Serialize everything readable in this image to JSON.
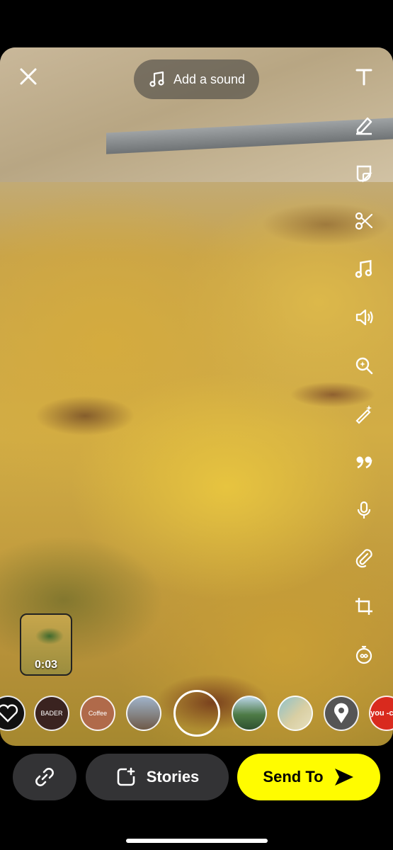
{
  "top": {
    "close_icon": "close-icon",
    "sound_label": "Add a sound",
    "sound_icon": "music-note-icon"
  },
  "tools": [
    {
      "name": "text-tool",
      "icon": "text-icon"
    },
    {
      "name": "draw-tool",
      "icon": "pencil-icon"
    },
    {
      "name": "sticker-tool",
      "icon": "sticker-icon"
    },
    {
      "name": "scissors-tool",
      "icon": "scissors-icon"
    },
    {
      "name": "music-tool",
      "icon": "music-note-icon"
    },
    {
      "name": "volume-tool",
      "icon": "volume-icon"
    },
    {
      "name": "search-lens-tool",
      "icon": "sparkle-search-icon"
    },
    {
      "name": "magic-tool",
      "icon": "magic-wand-icon"
    },
    {
      "name": "quote-tool",
      "icon": "quote-icon"
    },
    {
      "name": "voice-tool",
      "icon": "microphone-icon"
    },
    {
      "name": "attach-tool",
      "icon": "paperclip-icon"
    },
    {
      "name": "crop-tool",
      "icon": "crop-icon"
    },
    {
      "name": "timer-tool",
      "icon": "timer-icon"
    }
  ],
  "thumbnail": {
    "duration": "0:03"
  },
  "lenses": [
    {
      "name": "lens-heart",
      "label": "",
      "color": "#111111"
    },
    {
      "name": "lens-bader",
      "label": "BADER",
      "color": "#3a2320"
    },
    {
      "name": "lens-coffee",
      "label": "Coffee",
      "color": "#b06a4a"
    },
    {
      "name": "lens-landscape",
      "label": "",
      "color": "#6e7f9a"
    },
    {
      "name": "lens-capture",
      "label": "",
      "color": "transparent"
    },
    {
      "name": "lens-hills",
      "label": "",
      "color": "#4d7a45"
    },
    {
      "name": "lens-beach",
      "label": "",
      "color": "#8fc1c9"
    },
    {
      "name": "lens-location",
      "label": "",
      "color": "#555555"
    },
    {
      "name": "lens-you",
      "label": "you -con",
      "color": "#d92a1e"
    }
  ],
  "bottom": {
    "link_icon": "link-icon",
    "stories_label": "Stories",
    "stories_icon": "add-story-icon",
    "send_label": "Send To",
    "send_icon": "send-arrow-icon"
  },
  "colors": {
    "send_bg": "#fffc00",
    "pill_bg": "#333335"
  }
}
